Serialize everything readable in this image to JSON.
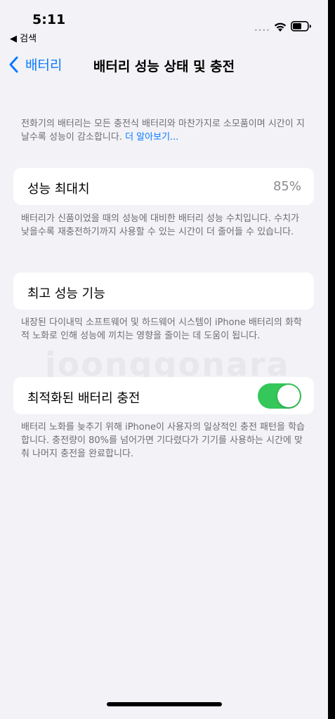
{
  "status_bar": {
    "time": "5:11",
    "back_app": "◀ 검색",
    "signal_dots": "••••",
    "icons": [
      "wifi-icon",
      "battery-icon"
    ]
  },
  "nav": {
    "back_label": "배터리",
    "title": "배터리 성능 상태 및 충전"
  },
  "intro": {
    "text": "전화기의 배터리는 모든 충전식 배터리와 마찬가지로 소모품이며 시간이 지날수록 성능이 감소합니다. ",
    "link": "더 알아보기..."
  },
  "max_capacity": {
    "label": "성능 최대치",
    "value": "85%",
    "footnote": "배터리가 신품이었을 때의 성능에 대비한 배터리 성능 수치입니다. 수치가 낮을수록 재충전하기까지 사용할 수 있는 시간이 더 줄어들 수 있습니다."
  },
  "peak_performance": {
    "label": "최고 성능 기능",
    "footnote": "내장된 다이내믹 소프트웨어 및 하드웨어 시스템이 iPhone 배터리의 화학적 노화로 인해 성능에 끼치는 영향을 줄이는 데 도움이 됩니다."
  },
  "optimized_charging": {
    "label": "최적화된 배터리 충전",
    "enabled": true,
    "footnote": "배터리 노화를 늦추기 위해 iPhone이 사용자의 일상적인 충전 패턴을 학습합니다. 충전량이 80%를 넘어가면 기다렸다가 기기를 사용하는 시간에 맞춰 나머지 충전을 완료합니다."
  },
  "watermark": "joonggonara",
  "colors": {
    "accent": "#0a7aff",
    "toggle_on": "#34c759",
    "background": "#f2f2f7"
  }
}
